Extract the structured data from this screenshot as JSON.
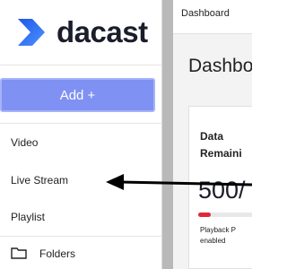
{
  "brand": {
    "name": "dacast",
    "mark_color": "#2a6cf5"
  },
  "sidebar": {
    "add_label": "Add +",
    "items": [
      {
        "label": "Video"
      },
      {
        "label": "Live Stream"
      },
      {
        "label": "Playlist"
      }
    ],
    "folders_label": "Folders",
    "folders_icon": "folder-icon"
  },
  "header": {
    "breadcrumb": "Dashboard"
  },
  "main": {
    "title": "Dashboa",
    "card": {
      "label": "Data Remaini",
      "value": "500/",
      "progress_color": "#e0283a",
      "progress_fraction": 0.2,
      "note_line1": "Playback P",
      "note_line2": "enabled"
    }
  },
  "colors": {
    "accent": "#7f91f2",
    "annotation_arrow": "#000000"
  },
  "annotation": {
    "icon": "arrow-left-icon"
  }
}
